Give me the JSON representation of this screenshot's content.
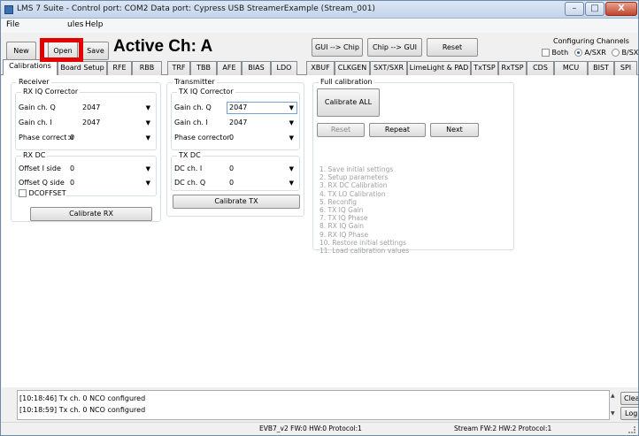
{
  "window": {
    "title": "LMS 7 Suite - Control port: COM2 Data port: Cypress USB StreamerExample (Stream_001)",
    "minimize_glyph": "–",
    "maximize_glyph": "□",
    "close_glyph": "X"
  },
  "menu": {
    "file": "File",
    "modules": "ules",
    "help": "Help"
  },
  "toolbar": {
    "new": "New",
    "open": "Open",
    "save": "Save",
    "active_channel": "Active Ch: A",
    "gui_to_chip": "GUI --> Chip",
    "chip_to_gui": "Chip --> GUI",
    "reset": "Reset",
    "configuring_channels": "Configuring Channels",
    "opt_both": "Both",
    "opt_a": "A/SXR",
    "opt_b": "B/SXT"
  },
  "tabs": [
    "Calibrations",
    "Board Setup",
    "RFE",
    "RBB",
    "TRF",
    "TBB",
    "AFE",
    "BIAS",
    "LDO",
    "XBUF",
    "CLKGEN",
    "SXT/SXR",
    "LimeLight & PAD",
    "TxTSP",
    "RxTSP",
    "CDS",
    "MCU",
    "BIST",
    "SPI"
  ],
  "receiver": {
    "title": "Receiver",
    "rxiq_title": "RX IQ Corrector",
    "gain_q_label": "Gain ch. Q",
    "gain_q_value": "2047",
    "gain_i_label": "Gain ch. I",
    "gain_i_value": "2047",
    "phase_label": "Phase corrector",
    "phase_value": "0",
    "rxdc_title": "RX DC",
    "offset_i_label": "Offset I side",
    "offset_i_value": "0",
    "offset_q_label": "Offset Q side",
    "offset_q_value": "0",
    "dcoffset_label": "DCOFFSET",
    "calibrate_rx": "Calibrate RX"
  },
  "transmitter": {
    "title": "Transmitter",
    "txiq_title": "TX IQ Corrector",
    "gain_q_label": "Gain ch. Q",
    "gain_q_value": "2047",
    "gain_i_label": "Gain ch. I",
    "gain_i_value": "2047",
    "phase_label": "Phase corrector",
    "phase_value": "0",
    "txdc_title": "TX DC",
    "dc_i_label": "DC ch. I",
    "dc_i_value": "0",
    "dc_q_label": "DC ch. Q",
    "dc_q_value": "0",
    "calibrate_tx": "Calibrate TX"
  },
  "full_calibration": {
    "title": "Full calibration",
    "calibrate_all": "Calibrate ALL",
    "reset": "Reset",
    "repeat": "Repeat",
    "next": "Next",
    "steps": [
      "1. Save initial settings",
      "2. Setup parameters",
      "3. RX DC Calibration",
      "4. TX LO Calibration",
      "5. Reconfig",
      "6. TX IQ Gain",
      "7. TX IQ Phase",
      "8. RX IQ Gain",
      "9. RX IQ Phase",
      "10. Restore initial settings",
      "11. Load calibration values"
    ]
  },
  "log": {
    "lines": [
      "[10:18:46] Tx ch. 0 NCO configured",
      "[10:18:59] Tx ch. 0 NCO configured"
    ],
    "clear": "Clea",
    "log": "Log"
  },
  "status": {
    "board": "EVB7_v2  FW:0 HW:0 Protocol:1",
    "stream": "Stream  FW:2 HW:2 Protocol:1"
  }
}
